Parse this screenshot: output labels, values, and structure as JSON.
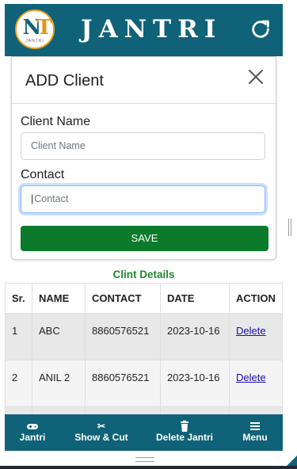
{
  "header": {
    "title": "JANTRI",
    "logo_letters": "NT",
    "logo_sub": "JANTRI"
  },
  "modal": {
    "title": "ADD Client",
    "client_name_label": "Client Name",
    "client_name_placeholder": "Client Name",
    "contact_label": "Contact",
    "contact_placeholder": "Contact",
    "save_label": "SAVE"
  },
  "table": {
    "title": "Clint Details",
    "headers": [
      "Sr.",
      "NAME",
      "CONTACT",
      "DATE",
      "ACTION"
    ],
    "rows": [
      {
        "sr": "1",
        "name": "ABC",
        "contact": "8860576521",
        "date": "2023-10-16",
        "action": "Delete"
      },
      {
        "sr": "2",
        "name": "ANIL 2",
        "contact": "8860576521",
        "date": "2023-10-16",
        "action": "Delete"
      }
    ]
  },
  "bottom_nav": [
    {
      "label": "Jantri",
      "icon": "gamepad-icon"
    },
    {
      "label": "Show & Cut",
      "icon": "scissors-icon"
    },
    {
      "label": "Delete Jantri",
      "icon": "trash-icon"
    },
    {
      "label": "Menu",
      "icon": "hamburger-menu-icon"
    }
  ],
  "colors": {
    "primary": "#0f6277",
    "save": "#0b7a2a",
    "table_title": "#1f8a2b",
    "link": "#1a0dab"
  }
}
